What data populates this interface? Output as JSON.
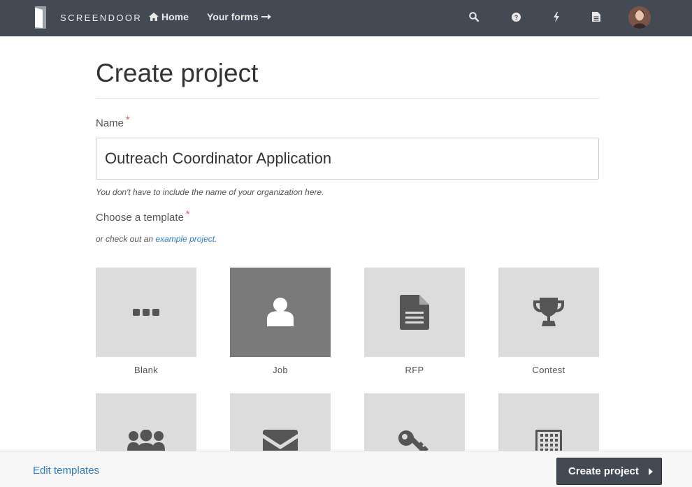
{
  "nav": {
    "brand": "SCREENDOOR",
    "home_label": "Home",
    "forms_label": "Your forms",
    "icons": [
      "search-icon",
      "help-icon",
      "bolt-icon",
      "document-icon"
    ]
  },
  "page": {
    "title": "Create project"
  },
  "form": {
    "name_label": "Name",
    "required_mark": "*",
    "name_value": "Outreach Coordinator Application",
    "name_hint": "You don't have to include the name of your organization here.",
    "template_label": "Choose a template",
    "template_hint_prefix": "or check out an ",
    "template_hint_link": "example project",
    "template_hint_suffix": "."
  },
  "templates": [
    {
      "label": "Blank",
      "icon": "ellipsis-icon",
      "selected": false
    },
    {
      "label": "Job",
      "icon": "user-icon",
      "selected": true
    },
    {
      "label": "RFP",
      "icon": "document-icon",
      "selected": false
    },
    {
      "label": "Contest",
      "icon": "trophy-icon",
      "selected": false
    },
    {
      "label": "",
      "icon": "group-icon",
      "selected": false
    },
    {
      "label": "",
      "icon": "envelope-icon",
      "selected": false
    },
    {
      "label": "",
      "icon": "key-icon",
      "selected": false
    },
    {
      "label": "",
      "icon": "building-icon",
      "selected": false
    }
  ],
  "footer": {
    "edit_templates": "Edit templates",
    "create_button": "Create project"
  },
  "colors": {
    "nav_bg": "#444a54",
    "link": "#2d7ec4",
    "tile_bg": "#dcdcdc",
    "tile_selected_bg": "#7a7a7a",
    "required": "#d9534f"
  }
}
